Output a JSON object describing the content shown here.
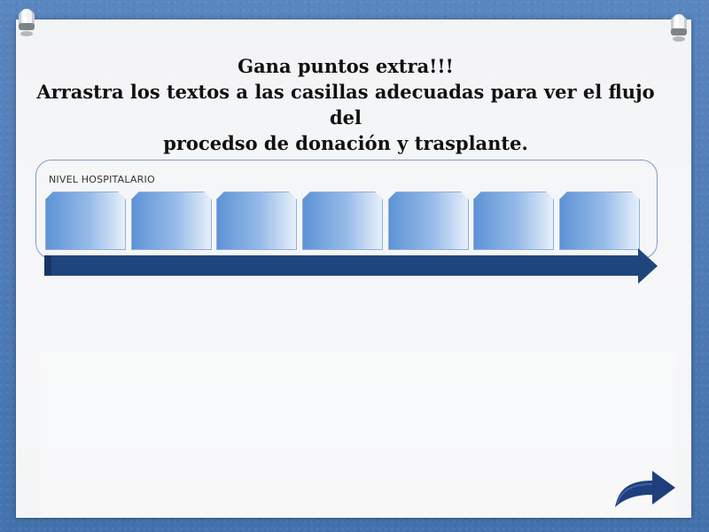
{
  "instructions": {
    "line1": "Gana puntos extra!!!",
    "line2": "Arrastra los textos a las casillas adecuadas para ver el flujo del",
    "line3": "procedso de donación y trasplante."
  },
  "flow": {
    "label": "NIVEL HOSPITALARIO",
    "slots": [
      "",
      "",
      "",
      "",
      "",
      "",
      ""
    ]
  },
  "colors": {
    "background": "#4a78b4",
    "arrow": "#1f467c",
    "slot_dark": "#5c92d6",
    "slot_light": "#e9f1fb"
  },
  "icons": {
    "next": "curved-arrow-right-icon",
    "pin": "pushpin-icon"
  }
}
